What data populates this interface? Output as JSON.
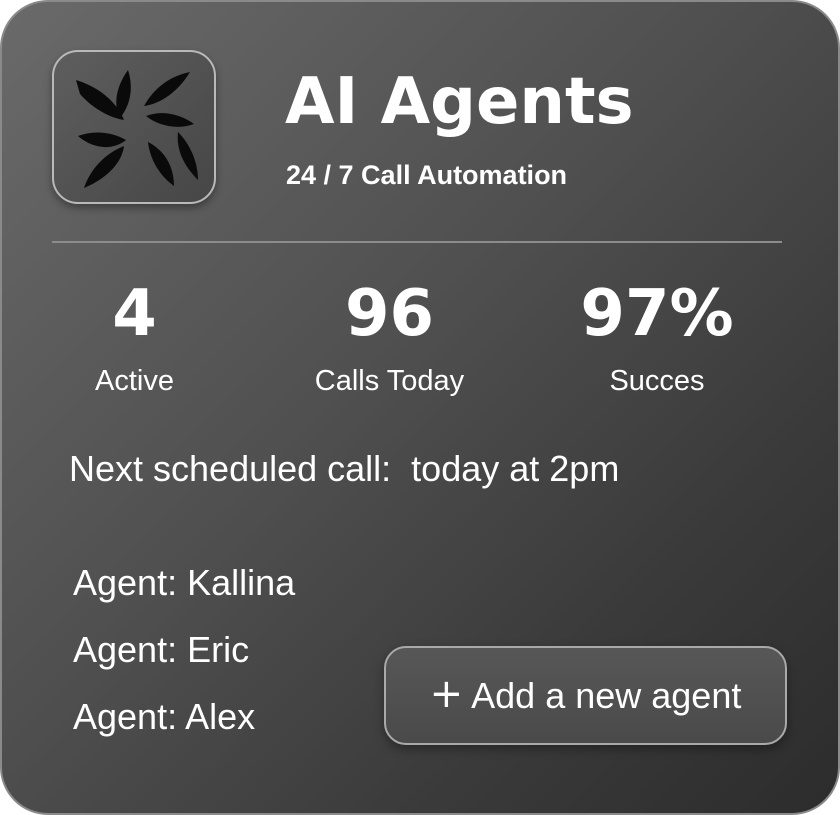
{
  "header": {
    "title": "AI Agents",
    "subtitle": "24 / 7 Call Automation",
    "logo_icon": "pinwheel-logo-icon"
  },
  "stats": [
    {
      "value": "4",
      "label": "Active"
    },
    {
      "value": "96",
      "label": "Calls Today"
    },
    {
      "value": "97%",
      "label": "Succes"
    }
  ],
  "next_call": {
    "text": "Next scheduled call:  today at 2pm"
  },
  "agents": [
    {
      "label": "Agent: Kallina"
    },
    {
      "label": "Agent: Eric"
    },
    {
      "label": "Agent: Alex"
    }
  ],
  "add_button": {
    "icon": "plus-icon",
    "label": "Add a new agent"
  },
  "colors": {
    "card_gradient_start": "#6a6a6a",
    "card_gradient_end": "#2c2c2c",
    "text": "#ffffff"
  }
}
